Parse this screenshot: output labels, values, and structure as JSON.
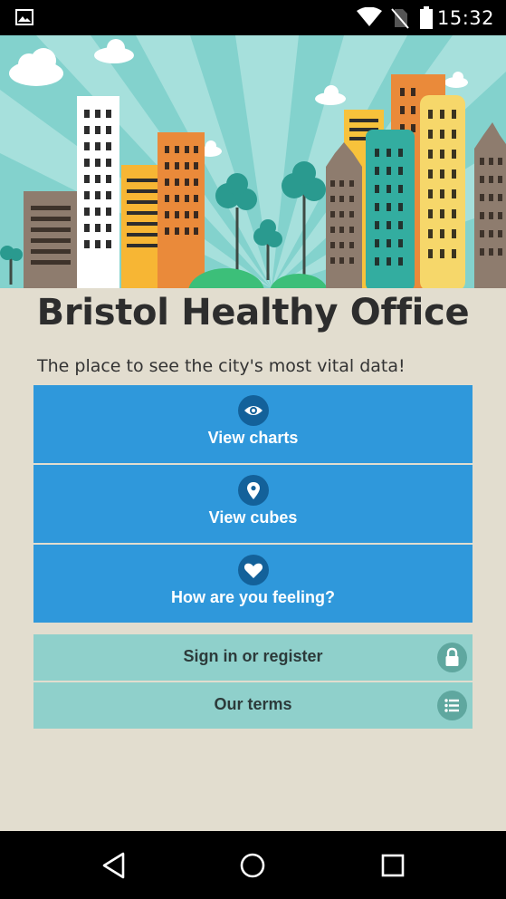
{
  "status_bar": {
    "time": "15:32",
    "icons": [
      "image-notification-icon",
      "wifi-icon",
      "no-sim-icon",
      "battery-icon"
    ]
  },
  "app": {
    "title": "Bristol Healthy Office",
    "subtitle": "The place to see the city's most vital data!"
  },
  "menu": {
    "view_charts": "View charts",
    "view_cubes": "View cubes",
    "feeling": "How are you feeling?"
  },
  "secondary": {
    "sign_in": "Sign in or register",
    "terms": "Our terms"
  },
  "nav": [
    "back-icon",
    "home-icon",
    "recents-icon"
  ],
  "colors": {
    "primary_button": "#2f98db",
    "secondary_button": "#8fd0cb",
    "background": "#e2ddcf",
    "sky": "#7fd0cc"
  }
}
